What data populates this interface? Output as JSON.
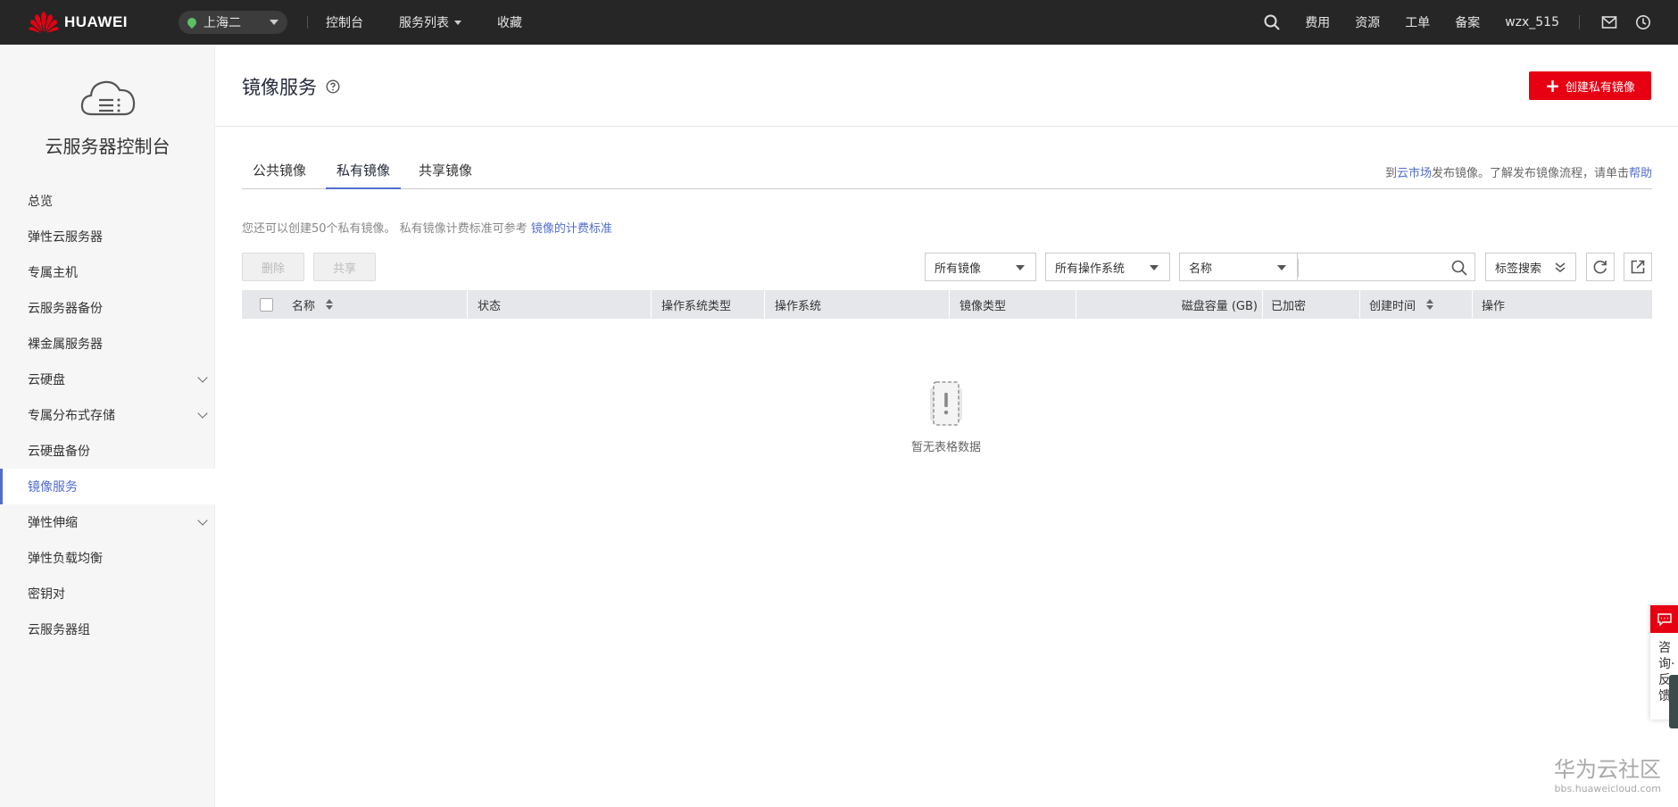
{
  "topbar": {
    "brand": "HUAWEI",
    "region": "上海二",
    "nav": [
      "控制台",
      "服务列表",
      "收藏"
    ],
    "right_items": [
      "费用",
      "资源",
      "工单",
      "备案"
    ],
    "username": "wzx_515"
  },
  "sidebar": {
    "title": "云服务器控制台",
    "items": [
      {
        "label": "总览"
      },
      {
        "label": "弹性云服务器"
      },
      {
        "label": "专属主机"
      },
      {
        "label": "云服务器备份"
      },
      {
        "label": "裸金属服务器"
      },
      {
        "label": "云硬盘"
      },
      {
        "label": "专属分布式存储"
      },
      {
        "label": "云硬盘备份"
      },
      {
        "label": "镜像服务"
      },
      {
        "label": "弹性伸缩"
      },
      {
        "label": "弹性负载均衡"
      },
      {
        "label": "密钥对"
      },
      {
        "label": "云服务器组"
      }
    ]
  },
  "main": {
    "title": "镜像服务",
    "create_button": "创建私有镜像",
    "tabs": [
      "公共镜像",
      "私有镜像",
      "共享镜像"
    ],
    "tab_info": {
      "pre": "到",
      "link1": "云市场",
      "mid": "发布镜像。了解发布镜像流程，请单击",
      "link2": "帮助"
    },
    "quota": {
      "text": "您还可以创建50个私有镜像。 私有镜像计费标准可参考 ",
      "link": "镜像的计费标准"
    },
    "toolbar": {
      "delete_label": "删除",
      "share_label": "共享",
      "filter_image": "所有镜像",
      "filter_os": "所有操作系统",
      "search_field": "名称",
      "tag_search": "标签搜索"
    },
    "table": {
      "columns": [
        "名称",
        "状态",
        "操作系统类型",
        "操作系统",
        "镜像类型",
        "磁盘容量 (GB)",
        "已加密",
        "创建时间",
        "操作"
      ]
    },
    "empty_text": "暂无表格数据"
  },
  "float_panel": {
    "text": "咨询·反馈"
  },
  "watermark": {
    "line1": "华为云社区",
    "line2": "bbs.huaweicloud.com"
  }
}
